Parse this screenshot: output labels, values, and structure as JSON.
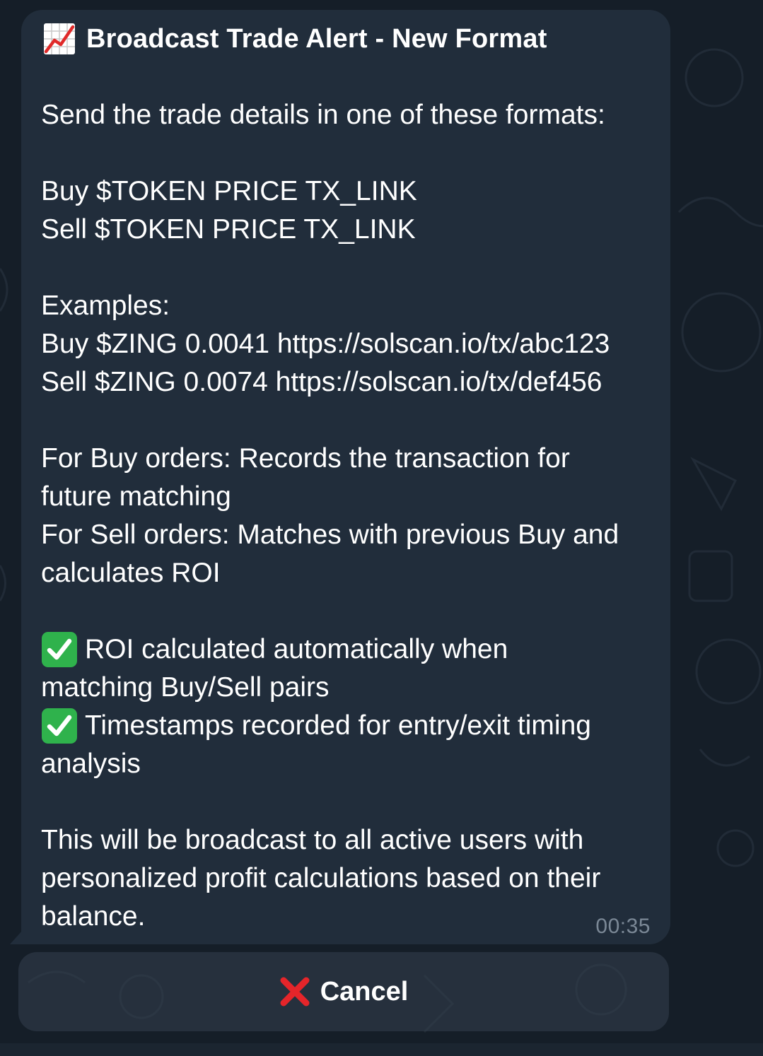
{
  "message": {
    "title_icon": "chart-increasing-icon",
    "title": "Broadcast Trade Alert - New Format",
    "lines": [
      "Send the trade details in one of these formats:",
      "Buy $TOKEN PRICE TX_LINK",
      "Sell $TOKEN PRICE TX_LINK",
      "Examples:",
      "Buy $ZING 0.0041 https://solscan.io/tx/abc123",
      "Sell $ZING 0.0074 https://solscan.io/tx/def456",
      "For Buy orders: Records the transaction for",
      "future matching",
      "For Sell orders: Matches with previous Buy and",
      "calculates ROI",
      "ROI calculated automatically when",
      "matching Buy/Sell pairs",
      "Timestamps recorded for entry/exit timing",
      "analysis",
      "This will be broadcast to all active users with",
      "personalized profit calculations based on their",
      "balance."
    ],
    "check_icon": "check-mark-button-icon",
    "time": "00:35"
  },
  "keyboard": {
    "cancel_icon": "cross-mark-icon",
    "cancel_label": "Cancel"
  },
  "colors": {
    "background": "#151e28",
    "bubble": "#212d3b",
    "text": "#ffffff",
    "time": "#7b8896",
    "check_green": "#2fb24c",
    "cross_red": "#e5252a"
  }
}
